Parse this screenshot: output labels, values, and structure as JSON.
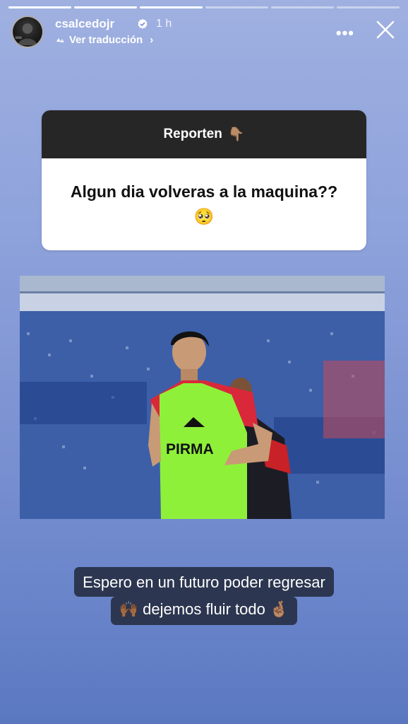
{
  "story": {
    "progress_segments_total": 6,
    "progress_segments_done": 3
  },
  "header": {
    "username": "csalcedojr",
    "time": "1 h",
    "translate_label": "Ver traducción",
    "more_icon": "more-horizontal-icon",
    "close_icon": "close-icon",
    "verified_icon": "verified-badge-icon"
  },
  "question_box": {
    "title": "Reporten",
    "title_emoji": "👇🏽",
    "question": "Algun dia volveras a la maquina??",
    "question_emoji": "🥺"
  },
  "photo": {
    "sponsor_text": "PIRMA"
  },
  "caption": {
    "line1": "Espero en un futuro poder regresar",
    "line2_emoji_start": "🙌🏾",
    "line2_text": "dejemos fluir todo",
    "line2_emoji_end": "🤞🏽"
  },
  "colors": {
    "background_top": "#9fb0e0",
    "background_bottom": "#5a78c0",
    "question_header": "#262626",
    "caption_bg": "#2c3650",
    "vest_green": "#8ff03a"
  }
}
